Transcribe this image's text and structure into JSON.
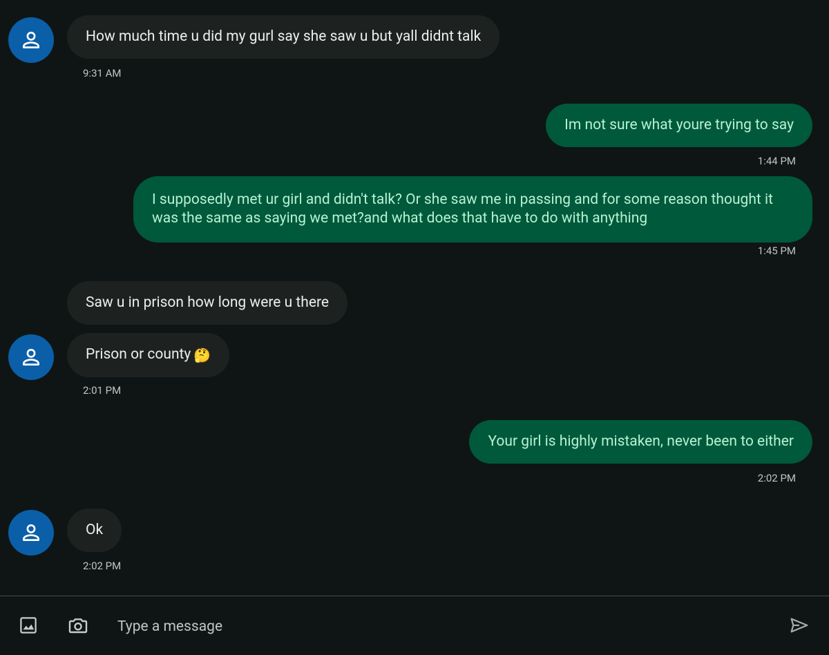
{
  "conversation": {
    "messages": [
      {
        "direction": "incoming",
        "text": "How much time u did my gurl say she saw u but yall didnt talk",
        "time": "9:31 AM"
      },
      {
        "direction": "outgoing",
        "text": "Im not sure what youre trying to say",
        "time": "1:44 PM"
      },
      {
        "direction": "outgoing",
        "text": "I supposedly met ur girl and didn't talk? Or she saw me in passing and for some reason thought it was the same as saying we met?and what does that have to do with anything",
        "time": "1:45 PM"
      },
      {
        "direction": "incoming",
        "text": "Saw u in prison how long were u there"
      },
      {
        "direction": "incoming",
        "text": "Prison or county",
        "emoji": "🤔",
        "time": "2:01 PM"
      },
      {
        "direction": "outgoing",
        "text": "Your girl is highly mistaken, never been to either",
        "time": "2:02 PM"
      },
      {
        "direction": "incoming",
        "text": "Ok",
        "time": "2:02 PM"
      }
    ]
  },
  "composer": {
    "placeholder": "Type a message",
    "icons": [
      "image-icon",
      "camera-icon",
      "send-icon"
    ]
  },
  "colors": {
    "background": "#0f1514",
    "incoming_bubble": "#1d2221",
    "outgoing_bubble": "#00593b",
    "outgoing_text": "#b6f2d3",
    "avatar": "#0a5fa8"
  }
}
